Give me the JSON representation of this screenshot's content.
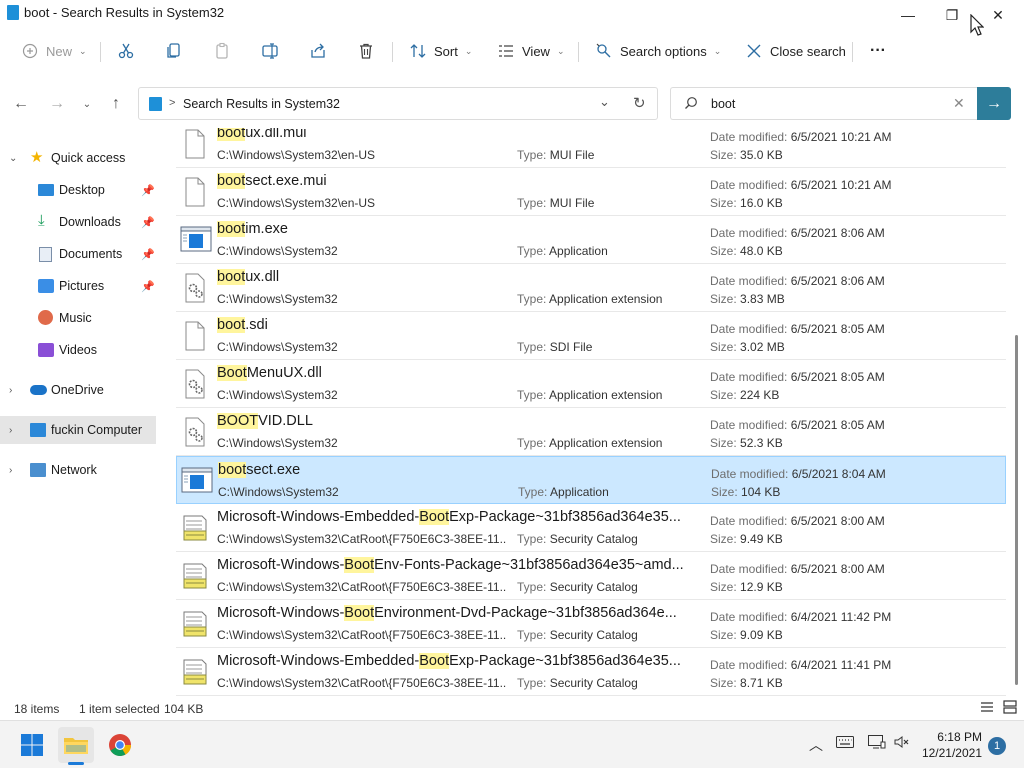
{
  "window": {
    "title": "boot - Search Results in System32",
    "minimize_glyph": "—",
    "maximize_glyph": "❐",
    "close_glyph": "✕"
  },
  "commandbar": {
    "new_label": "New",
    "sort_label": "Sort",
    "view_label": "View",
    "search_options_label": "Search options",
    "close_search_label": "Close search",
    "more_glyph": "···"
  },
  "address": {
    "breadcrumb": "Search Results in System32",
    "separator": ">"
  },
  "search": {
    "query": "boot"
  },
  "sidebar": {
    "items": [
      {
        "label": "Quick access",
        "icon": "star-icon"
      },
      {
        "label": "Desktop",
        "icon": "desktop-icon"
      },
      {
        "label": "Downloads",
        "icon": "download-icon"
      },
      {
        "label": "Documents",
        "icon": "documents-icon"
      },
      {
        "label": "Pictures",
        "icon": "pictures-icon"
      },
      {
        "label": "Music",
        "icon": "music-icon"
      },
      {
        "label": "Videos",
        "icon": "videos-icon"
      },
      {
        "label": "OneDrive",
        "icon": "cloud-icon"
      },
      {
        "label": "fuckin Computer",
        "icon": "computer-icon"
      },
      {
        "label": "Network",
        "icon": "network-icon"
      }
    ]
  },
  "labels": {
    "date_modified": "Date modified:",
    "size": "Size:",
    "type": "Type:"
  },
  "files": [
    {
      "pre": "",
      "match": "boot",
      "post": "ux.dll.mui",
      "path": "C:\\Windows\\System32\\en-US",
      "type": "MUI File",
      "date": "6/5/2021 10:21 AM",
      "size": "35.0 KB",
      "icon": "blank-file-icon"
    },
    {
      "pre": "",
      "match": "boot",
      "post": "sect.exe.mui",
      "path": "C:\\Windows\\System32\\en-US",
      "type": "MUI File",
      "date": "6/5/2021 10:21 AM",
      "size": "16.0 KB",
      "icon": "blank-file-icon"
    },
    {
      "pre": "",
      "match": "boot",
      "post": "im.exe",
      "path": "C:\\Windows\\System32",
      "type": "Application",
      "date": "6/5/2021 8:06 AM",
      "size": "48.0 KB",
      "icon": "application-icon"
    },
    {
      "pre": "",
      "match": "boot",
      "post": "ux.dll",
      "path": "C:\\Windows\\System32",
      "type": "Application extension",
      "date": "6/5/2021 8:06 AM",
      "size": "3.83 MB",
      "icon": "dll-gear-icon"
    },
    {
      "pre": "",
      "match": "boot",
      "post": ".sdi",
      "path": "C:\\Windows\\System32",
      "type": "SDI File",
      "date": "6/5/2021 8:05 AM",
      "size": "3.02 MB",
      "icon": "blank-file-icon"
    },
    {
      "pre": "",
      "match": "Boot",
      "post": "MenuUX.dll",
      "path": "C:\\Windows\\System32",
      "type": "Application extension",
      "date": "6/5/2021 8:05 AM",
      "size": "224 KB",
      "icon": "dll-gear-icon"
    },
    {
      "pre": "",
      "match": "BOOT",
      "post": "VID.DLL",
      "path": "C:\\Windows\\System32",
      "type": "Application extension",
      "date": "6/5/2021 8:05 AM",
      "size": "52.3 KB",
      "icon": "dll-gear-icon"
    },
    {
      "pre": "",
      "match": "boot",
      "post": "sect.exe",
      "path": "C:\\Windows\\System32",
      "type": "Application",
      "date": "6/5/2021 8:04 AM",
      "size": "104 KB",
      "icon": "application-icon",
      "selected": true
    },
    {
      "pre": "Microsoft-Windows-Embedded-",
      "match": "Boot",
      "post": "Exp-Package~31bf3856ad364e35...",
      "path": "C:\\Windows\\System32\\CatRoot\\{F750E6C3-38EE-11...",
      "type": "Security Catalog",
      "date": "6/5/2021 8:00 AM",
      "size": "9.49 KB",
      "icon": "catalog-icon"
    },
    {
      "pre": "Microsoft-Windows-",
      "match": "Boot",
      "post": "Env-Fonts-Package~31bf3856ad364e35~amd...",
      "path": "C:\\Windows\\System32\\CatRoot\\{F750E6C3-38EE-11...",
      "type": "Security Catalog",
      "date": "6/5/2021 8:00 AM",
      "size": "12.9 KB",
      "icon": "catalog-icon"
    },
    {
      "pre": "Microsoft-Windows-",
      "match": "Boot",
      "post": "Environment-Dvd-Package~31bf3856ad364e...",
      "path": "C:\\Windows\\System32\\CatRoot\\{F750E6C3-38EE-11...",
      "type": "Security Catalog",
      "date": "6/4/2021 11:42 PM",
      "size": "9.09 KB",
      "icon": "catalog-icon"
    },
    {
      "pre": "Microsoft-Windows-Embedded-",
      "match": "Boot",
      "post": "Exp-Package~31bf3856ad364e35...",
      "path": "C:\\Windows\\System32\\CatRoot\\{F750E6C3-38EE-11...",
      "type": "Security Catalog",
      "date": "6/4/2021 11:41 PM",
      "size": "8.71 KB",
      "icon": "catalog-icon"
    }
  ],
  "status": {
    "item_count": "18 items",
    "selection": "1 item selected",
    "selection_size": "104 KB"
  },
  "taskbar": {
    "time": "6:18 PM",
    "date": "12/21/2021",
    "notification_count": "1"
  },
  "colors": {
    "accent": "#2d7d9a",
    "highlight": "#fff59d",
    "selection": "#cce8ff"
  }
}
